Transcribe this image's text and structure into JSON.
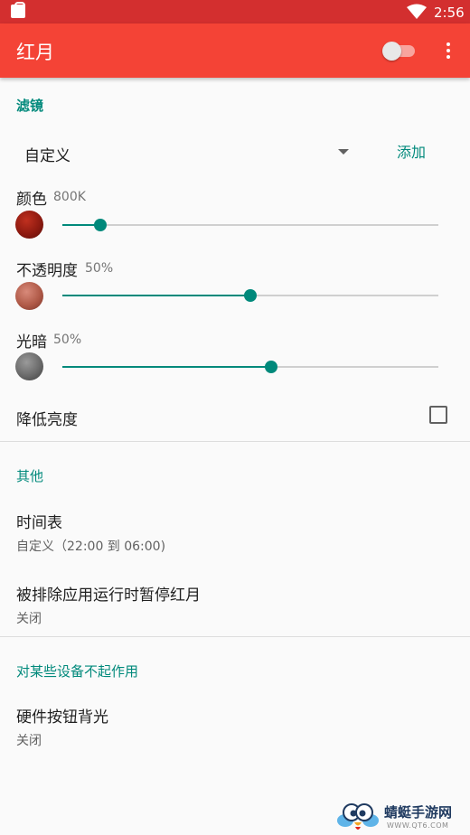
{
  "status_bar": {
    "time": "2:56"
  },
  "app_bar": {
    "title": "红月",
    "toggle_on": false
  },
  "filter_section": {
    "header": "滤镜",
    "preset": "自定义",
    "add_label": "添加",
    "color": {
      "label": "颜色",
      "value": "800K",
      "level": 0.1
    },
    "opacity": {
      "label": "不透明度",
      "value": "50%",
      "level": 0.5
    },
    "dim": {
      "label": "光暗",
      "value": "50%",
      "level": 0.555
    },
    "lower_brightness": {
      "label": "降低亮度",
      "checked": false
    }
  },
  "other_section": {
    "header": "其他",
    "schedule": {
      "title": "时间表",
      "summary": "自定义（22:00 到 06:00)"
    },
    "pause_excluded": {
      "title": "被排除应用运行时暂停红月",
      "summary": "关闭"
    }
  },
  "device_section": {
    "header": "对某些设备不起作用",
    "button_backlight": {
      "title": "硬件按钮背光",
      "summary": "关闭"
    }
  },
  "watermark": {
    "title": "蜻蜓手游网",
    "url": "WWW.QT6.COM"
  },
  "colors": {
    "status_bar": "#d32f2f",
    "app_bar": "#f44336",
    "accent": "#00897b"
  }
}
